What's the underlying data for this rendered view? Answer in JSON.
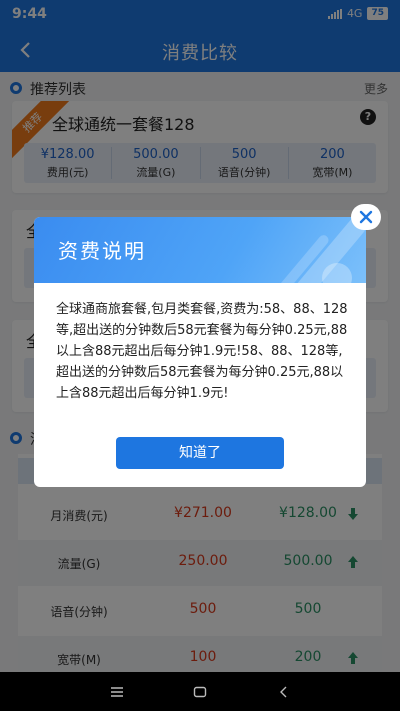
{
  "status": {
    "time": "9:44",
    "network": "4G",
    "battery": "75"
  },
  "header": {
    "title": "消费比较"
  },
  "recommend": {
    "title": "推荐列表",
    "more": "更多",
    "card": {
      "badge": "推荐",
      "title": "全球通统一套餐128",
      "stats": [
        {
          "value": "¥128.00",
          "label": "费用(元)"
        },
        {
          "value": "500.00",
          "label": "流量(G)"
        },
        {
          "value": "500",
          "label": "语音(分钟)"
        },
        {
          "value": "200",
          "label": "宽带(M)"
        }
      ]
    },
    "stub2_title": "全",
    "stub3_title": "全"
  },
  "compare": {
    "title": "消",
    "rows": [
      {
        "label": "月消费(元)",
        "a": "¥271.00",
        "b": "¥128.00",
        "trend": "down"
      },
      {
        "label": "流量(G)",
        "a": "250.00",
        "b": "500.00",
        "trend": "up"
      },
      {
        "label": "语音(分钟)",
        "a": "500",
        "b": "500",
        "trend": ""
      },
      {
        "label": "宽带(M)",
        "a": "100",
        "b": "200",
        "trend": "up"
      }
    ]
  },
  "dialog": {
    "title": "资费说明",
    "body": "全球通商旅套餐,包月类套餐,资费为:58、88、128等,超出送的分钟数后58元套餐为每分钟0.25元,88以上含88元超出后每分钟1.9元!58、88、128等,超出送的分钟数后58元套餐为每分钟0.25元,88以上含88元超出后每分钟1.9元!",
    "confirm": "知道了"
  },
  "colors": {
    "primary": "#1e76e0",
    "badge": "#f07a1c",
    "price_red": "#d9391b",
    "price_green": "#2a9164"
  }
}
